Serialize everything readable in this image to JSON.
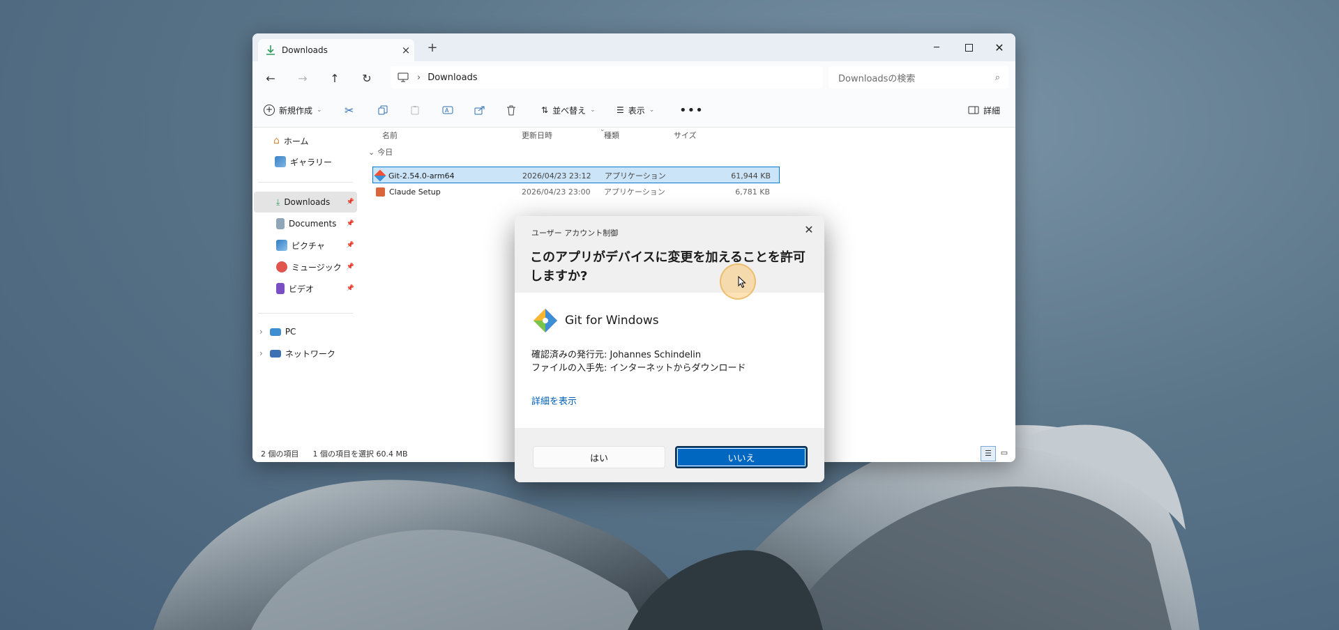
{
  "explorer": {
    "tab_title": "Downloads",
    "address": {
      "current_folder": "Downloads",
      "search_placeholder": "Downloadsの検索"
    },
    "toolbar": {
      "new": "新規作成",
      "sort": "並べ替え",
      "view": "表示",
      "details": "詳細"
    },
    "sidebar": {
      "items": [
        {
          "label": "ホーム"
        },
        {
          "label": "ギャラリー"
        },
        {
          "label": "Downloads"
        },
        {
          "label": "Documents"
        },
        {
          "label": "ピクチャ"
        },
        {
          "label": "ミュージック"
        },
        {
          "label": "ビデオ"
        },
        {
          "label": "PC"
        },
        {
          "label": "ネットワーク"
        }
      ]
    },
    "columns": {
      "name": "名前",
      "date": "更新日時",
      "type": "種類",
      "size": "サイズ"
    },
    "group_label": "今日",
    "files": [
      {
        "name": "Git-2.54.0-arm64",
        "date": "2026/04/23 23:12",
        "type": "アプリケーション",
        "size": "61,944 KB"
      },
      {
        "name": "Claude Setup",
        "date": "2026/04/23 23:00",
        "type": "アプリケーション",
        "size": "6,781 KB"
      }
    ],
    "status": {
      "count": "2 個の項目",
      "selection": "1 個の項目を選択  60.4 MB"
    }
  },
  "uac": {
    "title": "ユーザー アカウント制御",
    "question": "このアプリがデバイスに変更を加えることを許可しますか?",
    "app_name": "Git for Windows",
    "publisher": "確認済みの発行元: Johannes Schindelin",
    "origin": "ファイルの入手先: インターネットからダウンロード",
    "details_link": "詳細を表示",
    "yes": "はい",
    "no": "いいえ"
  },
  "colors": {
    "accent": "#0067c0",
    "selection": "#cce4f7"
  }
}
